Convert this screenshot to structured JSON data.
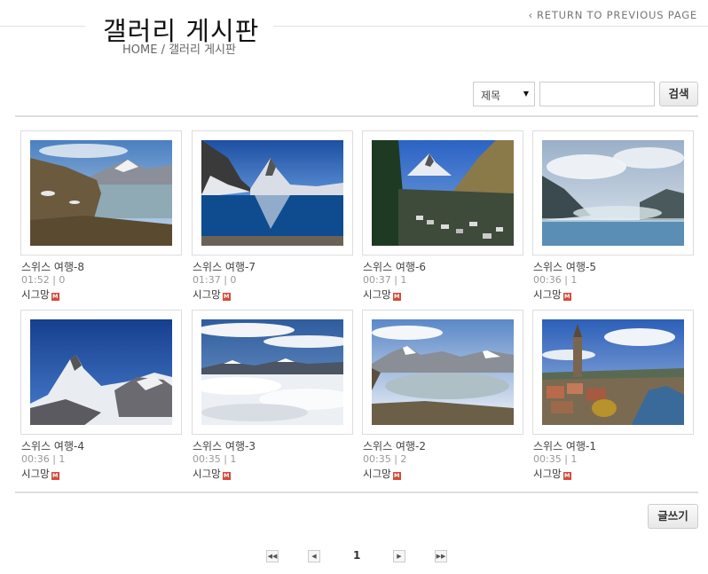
{
  "header": {
    "title": "갤러리 게시판",
    "breadcrumb": "HOME / 갤러리 게시판",
    "return_link": "RETURN TO PREVIOUS PAGE"
  },
  "search": {
    "select_value": "제목",
    "input_value": "",
    "button_label": "검색"
  },
  "posts": [
    {
      "title": "스위스 여행-8",
      "meta": "01:52 | 0",
      "author": "시그망",
      "badge": "M",
      "image": "alpine-lake-mountains"
    },
    {
      "title": "스위스 여행-7",
      "meta": "01:37 | 0",
      "author": "시그망",
      "badge": "M",
      "image": "matterhorn-reflection-lake"
    },
    {
      "title": "스위스 여행-6",
      "meta": "00:37 | 1",
      "author": "시그망",
      "badge": "M",
      "image": "matterhorn-village"
    },
    {
      "title": "스위스 여행-5",
      "meta": "00:36 | 1",
      "author": "시그망",
      "badge": "M",
      "image": "misty-thermal-pool"
    },
    {
      "title": "스위스 여행-4",
      "meta": "00:36 | 1",
      "author": "시그망",
      "badge": "M",
      "image": "matterhorn-snow"
    },
    {
      "title": "스위스 여행-3",
      "meta": "00:35 | 1",
      "author": "시그망",
      "badge": "M",
      "image": "above-the-clouds"
    },
    {
      "title": "스위스 여행-2",
      "meta": "00:35 | 2",
      "author": "시그망",
      "badge": "M",
      "image": "mountain-lake-panorama"
    },
    {
      "title": "스위스 여행-1",
      "meta": "00:35 | 1",
      "author": "시그망",
      "badge": "M",
      "image": "bern-cityscape"
    }
  ],
  "actions": {
    "write_label": "글쓰기"
  },
  "pagination": {
    "first_icon": "double-chevron-left-icon",
    "prev_icon": "chevron-left-icon",
    "current_page": "1",
    "next_icon": "chevron-right-icon",
    "last_icon": "double-chevron-right-icon"
  },
  "colors": {
    "badge": "#d24d3a",
    "rule": "#dddddd"
  }
}
